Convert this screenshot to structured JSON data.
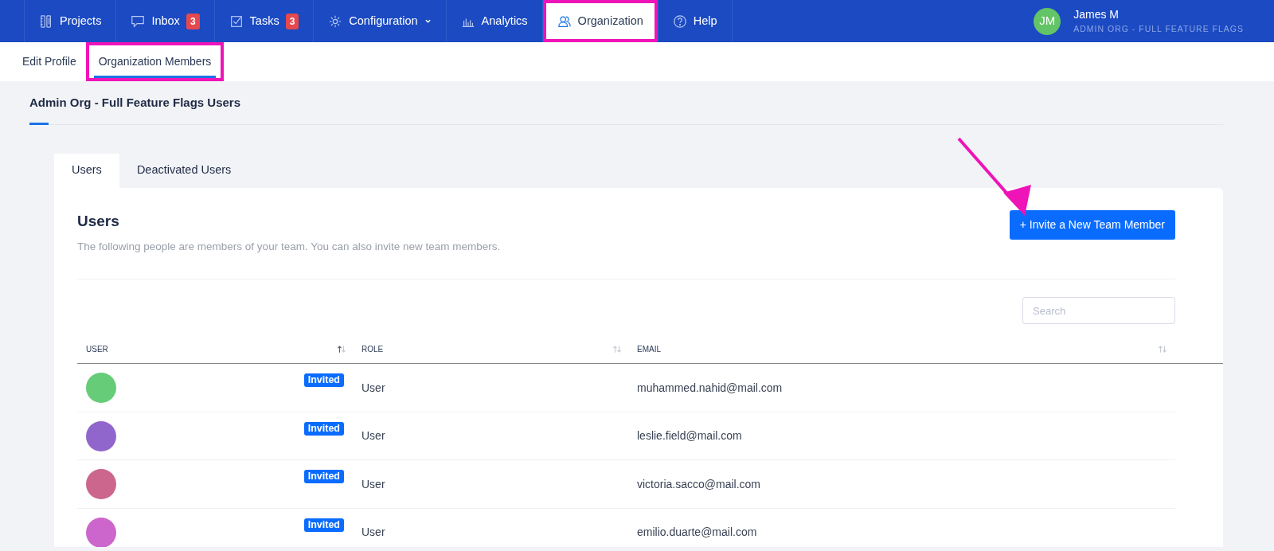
{
  "navbar": {
    "items": [
      {
        "label": "Projects",
        "selected": false,
        "highlighted": false
      },
      {
        "label": "Inbox",
        "badge": "3",
        "selected": false,
        "highlighted": false
      },
      {
        "label": "Tasks",
        "badge": "3",
        "selected": false,
        "highlighted": false
      },
      {
        "label": "Configuration",
        "dropdown": true,
        "selected": false,
        "highlighted": false
      },
      {
        "label": "Analytics",
        "selected": false,
        "highlighted": false
      },
      {
        "label": "Organization",
        "selected": true,
        "highlighted": true
      },
      {
        "label": "Help",
        "selected": false,
        "highlighted": false
      }
    ],
    "user": {
      "initials": "JM",
      "name": "James M",
      "org": "ADMIN ORG - FULL FEATURE FLAGS"
    }
  },
  "subnav": [
    {
      "label": "Edit Profile",
      "selected": false,
      "highlighted": false
    },
    {
      "label": "Organization Members",
      "selected": true,
      "highlighted": true
    }
  ],
  "page_title": "Admin Org - Full Feature Flags Users",
  "tabs": [
    {
      "label": "Users",
      "selected": true
    },
    {
      "label": "Deactivated Users",
      "selected": false
    }
  ],
  "panel": {
    "title": "Users",
    "description": "The following people are members of your team. You can also invite new team members.",
    "invite_button": "+ Invite a New Team Member",
    "search": {
      "placeholder": "Search"
    }
  },
  "table": {
    "columns": [
      {
        "label": "USER",
        "sorted": true
      },
      {
        "label": "ROLE",
        "sorted": false
      },
      {
        "label": "EMAIL",
        "sorted": false
      }
    ],
    "rows": [
      {
        "color": "#66cc77",
        "status": "Invited",
        "role": "User",
        "email": "muhammed.nahid@mail.com"
      },
      {
        "color": "#9166cc",
        "status": "Invited",
        "role": "User",
        "email": "leslie.field@mail.com"
      },
      {
        "color": "#cc668c",
        "status": "Invited",
        "role": "User",
        "email": "victoria.sacco@mail.com"
      },
      {
        "color": "#cc66cc",
        "status": "Invited",
        "role": "User",
        "email": "emilio.duarte@mail.com"
      }
    ]
  },
  "annotation": {
    "arrow": true
  }
}
